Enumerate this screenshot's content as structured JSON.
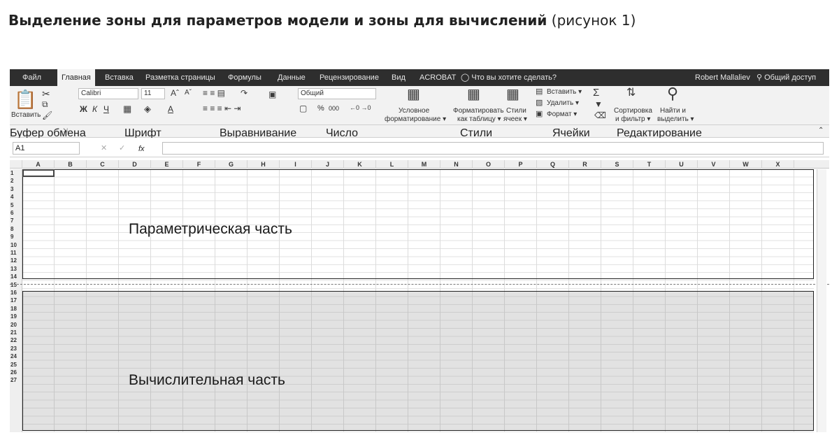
{
  "caption": {
    "bold": "Выделение зоны для параметров модели и зоны для вычислений",
    "normal": " (рисунок 1)"
  },
  "menu": {
    "tabs": [
      "Файл",
      "Главная",
      "Вставка",
      "Разметка страницы",
      "Формулы",
      "Данные",
      "Рецензирование",
      "Вид",
      "ACROBAT"
    ],
    "active_tab": "Главная",
    "tell_me": "Что вы хотите сделать?",
    "user": "Robert Mallaliev",
    "share": "Общий доступ"
  },
  "ribbon": {
    "paste": "Вставить",
    "font_name": "Calibri",
    "font_size": "11",
    "bold": "Ж",
    "italic": "К",
    "underline": "Ч",
    "font_color": "А",
    "number_format": "Общий",
    "percent": "%",
    "thousands": "000",
    "cond_format_1": "Условное",
    "cond_format_2": "форматирование ▾",
    "format_table_1": "Форматировать",
    "format_table_2": "как таблицу ▾",
    "cell_styles_1": "Стили",
    "cell_styles_2": "ячеек ▾",
    "insert": "Вставить ▾",
    "delete": "Удалить ▾",
    "format": "Формат ▾",
    "sort_1": "Сортировка",
    "sort_2": "и фильтр ▾",
    "find_1": "Найти и",
    "find_2": "выделить ▾",
    "groups": {
      "clipboard": "Буфер обмена",
      "font": "Шрифт",
      "alignment": "Выравнивание",
      "number": "Число",
      "styles": "Стили",
      "cells": "Ячейки",
      "editing": "Редактирование"
    }
  },
  "formula_bar": {
    "name_box": "A1",
    "fx": "fx",
    "formula": ""
  },
  "columns": [
    "A",
    "B",
    "C",
    "D",
    "E",
    "F",
    "G",
    "H",
    "I",
    "J",
    "K",
    "L",
    "M",
    "N",
    "O",
    "P",
    "Q",
    "R",
    "S",
    "T",
    "U",
    "V",
    "W",
    "X"
  ],
  "rows": [
    "1",
    "2",
    "3",
    "4",
    "5",
    "6",
    "7",
    "8",
    "9",
    "10",
    "11",
    "12",
    "13",
    "14",
    "15",
    "16",
    "17",
    "18",
    "19",
    "20",
    "21",
    "22",
    "23",
    "24",
    "25",
    "26",
    "27"
  ],
  "zones": {
    "parametric": "Параметрическая часть",
    "computational": "Вычислительная часть"
  },
  "colors": {
    "menu_bg": "#2e2e2e",
    "ribbon_bg": "#f2f2f2",
    "zone_fill": "#d7d7d7",
    "zone_border": "#222222"
  },
  "icons": [
    "paste-icon",
    "cut-icon",
    "copy-icon",
    "format-painter-icon",
    "font-grow-icon",
    "font-shrink-icon",
    "borders-icon",
    "fill-color-icon",
    "align-icon",
    "wrap-text-icon",
    "merge-icon",
    "currency-icon",
    "cond-format-icon",
    "format-table-icon",
    "cell-styles-icon",
    "insert-cells-icon",
    "delete-cells-icon",
    "format-cells-icon",
    "autosum-icon",
    "fill-icon",
    "clear-icon",
    "sort-filter-icon",
    "find-icon",
    "lightbulb-icon",
    "person-icon",
    "dialog-launcher-icon",
    "collapse-ribbon-icon"
  ]
}
